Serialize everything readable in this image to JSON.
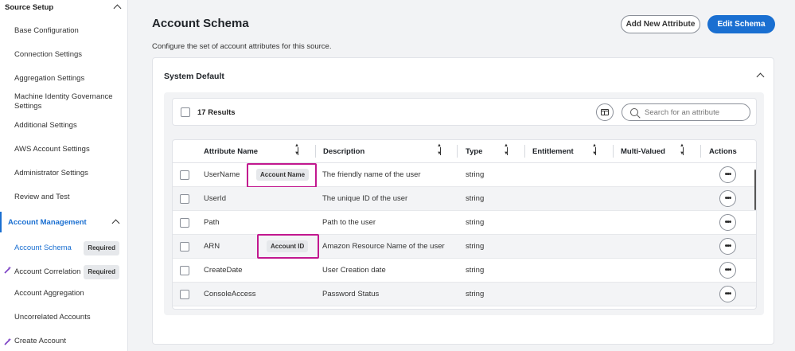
{
  "sidebar": {
    "source_setup": "Source Setup",
    "items": [
      {
        "label": "Base Configuration"
      },
      {
        "label": "Connection Settings"
      },
      {
        "label": "Aggregation Settings"
      },
      {
        "label": "Machine Identity Governance Settings"
      },
      {
        "label": "Additional Settings"
      },
      {
        "label": "AWS Account Settings"
      },
      {
        "label": "Administrator Settings"
      },
      {
        "label": "Review and Test"
      }
    ],
    "account_management": "Account Management",
    "mgmt_items": [
      {
        "label": "Account Schema",
        "badge": "Required"
      },
      {
        "label": "Account Correlation",
        "badge": "Required",
        "icon": "wand-icon"
      },
      {
        "label": "Account Aggregation"
      },
      {
        "label": "Uncorrelated Accounts"
      },
      {
        "label": "Create Account",
        "icon": "wand-icon"
      }
    ]
  },
  "header": {
    "title": "Account Schema",
    "subtitle": "Configure the set of account attributes for this source.",
    "add_button": "Add New Attribute",
    "edit_button": "Edit Schema"
  },
  "card": {
    "title": "System Default",
    "results": "17 Results",
    "search_placeholder": "Search for an attribute"
  },
  "table": {
    "columns": [
      "Attribute Name",
      "Description",
      "Type",
      "Entitlement",
      "Multi-Valued",
      "Actions"
    ],
    "rows": [
      {
        "name": "UserName",
        "tag": "Account Name",
        "description": "The friendly name of the user",
        "type": "string"
      },
      {
        "name": "UserId",
        "tag": "",
        "description": "The unique ID of the user",
        "type": "string"
      },
      {
        "name": "Path",
        "tag": "",
        "description": "Path to the user",
        "type": "string"
      },
      {
        "name": "ARN",
        "tag": "Account ID",
        "description": "Amazon Resource Name of the user",
        "type": "string"
      },
      {
        "name": "CreateDate",
        "tag": "",
        "description": "User Creation date",
        "type": "string"
      },
      {
        "name": "ConsoleAccess",
        "tag": "",
        "description": "Password Status",
        "type": "string"
      }
    ],
    "actions_glyph": "•••"
  },
  "colors": {
    "accent": "#1a6fd1",
    "highlight": "#c2188f",
    "wand": "#7b3fc4"
  }
}
